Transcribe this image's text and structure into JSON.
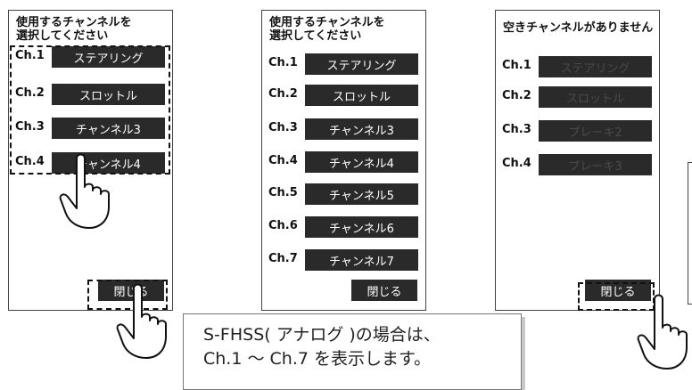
{
  "panels": [
    {
      "title": "使用するチャンネルを\n選択してください",
      "rows": [
        {
          "ch": "Ch.1",
          "label": "ステアリング"
        },
        {
          "ch": "Ch.2",
          "label": "スロットル"
        },
        {
          "ch": "Ch.3",
          "label": "チャンネル3"
        },
        {
          "ch": "Ch.4",
          "label": "チャンネル4"
        }
      ],
      "close_label": "閉じる"
    },
    {
      "title": "使用するチャンネルを\n選択してください",
      "rows": [
        {
          "ch": "Ch.1",
          "label": "ステアリング"
        },
        {
          "ch": "Ch.2",
          "label": "スロットル"
        },
        {
          "ch": "Ch.3",
          "label": "チャンネル3"
        },
        {
          "ch": "Ch.4",
          "label": "チャンネル4"
        },
        {
          "ch": "Ch.5",
          "label": "チャンネル5"
        },
        {
          "ch": "Ch.6",
          "label": "チャンネル6"
        },
        {
          "ch": "Ch.7",
          "label": "チャンネル7"
        }
      ],
      "close_label": "閉じる"
    },
    {
      "title": "空きチャンネルがありません",
      "rows": [
        {
          "ch": "Ch.1",
          "label": "ステアリング"
        },
        {
          "ch": "Ch.2",
          "label": "スロットル"
        },
        {
          "ch": "Ch.3",
          "label": "ブレーキ2"
        },
        {
          "ch": "Ch.4",
          "label": "ブレーキ3"
        }
      ],
      "close_label": "閉じる"
    }
  ],
  "callout": {
    "line1": "S-FHSS( アナログ )の場合は、",
    "line2": "Ch.1 ～ Ch.7 を表示します。"
  },
  "icons": [
    "pointing-hand-icon"
  ],
  "colors": {
    "button_bg": "#2a2a2a",
    "button_text": "#ffffff",
    "disabled_text": "#4a4a4a"
  }
}
